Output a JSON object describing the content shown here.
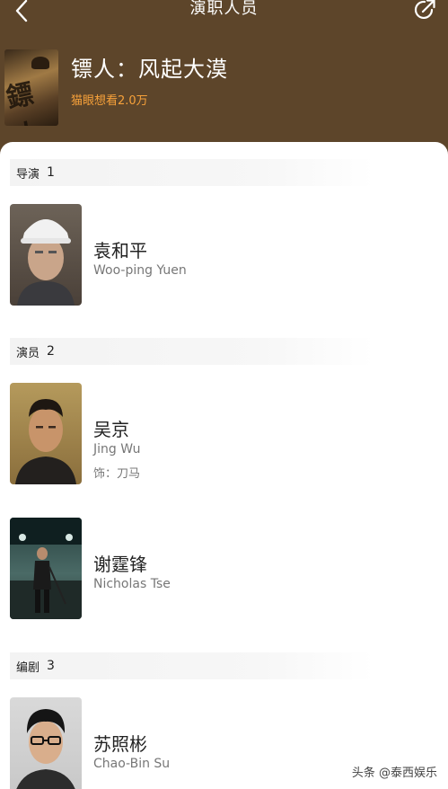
{
  "nav": {
    "title": "演职人员"
  },
  "movie": {
    "title": "镖人：风起大漠",
    "want_count": "猫眼想看2.0万",
    "poster_glyph": "鏢人"
  },
  "sections": [
    {
      "label": "导演",
      "count": "1",
      "people": [
        {
          "name": "袁和平",
          "en_name": "Woo-ping Yuen",
          "role": ""
        }
      ]
    },
    {
      "label": "演员",
      "count": "2",
      "people": [
        {
          "name": "吴京",
          "en_name": "Jing Wu",
          "role": "饰：刀马"
        },
        {
          "name": "谢霆锋",
          "en_name": "Nicholas Tse",
          "role": ""
        }
      ]
    },
    {
      "label": "编剧",
      "count": "3",
      "people": [
        {
          "name": "苏照彬",
          "en_name": "Chao-Bin Su",
          "role": ""
        }
      ]
    }
  ],
  "watermark": "头条 @泰西娱乐",
  "colors": {
    "header_bg": "#5d452a",
    "accent": "#f7a13a"
  }
}
